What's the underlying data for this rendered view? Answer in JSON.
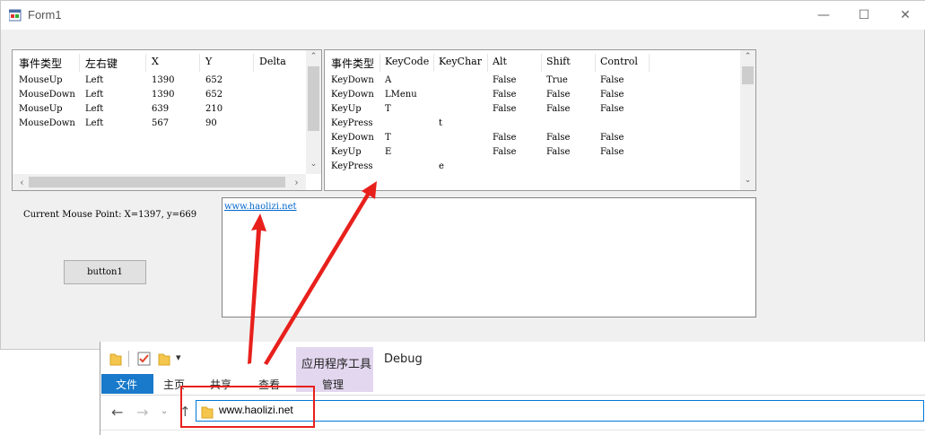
{
  "window": {
    "title": "Form1",
    "minimize": "—",
    "maximize": "☐",
    "close": "✕"
  },
  "mouse_list": {
    "columns": [
      "事件类型",
      "左右键",
      "X",
      "Y",
      "Delta"
    ],
    "rows": [
      [
        "MouseUp",
        "Left",
        "1390",
        "652"
      ],
      [
        "MouseDown",
        "Left",
        "1390",
        "652"
      ],
      [
        "MouseUp",
        "Left",
        "639",
        "210"
      ],
      [
        "MouseDown",
        "Left",
        "567",
        "90"
      ]
    ]
  },
  "key_list": {
    "columns": [
      "事件类型",
      "KeyCode",
      "KeyChar",
      "Alt",
      "Shift",
      "Control"
    ],
    "rows": [
      [
        "KeyDown",
        "A",
        "",
        "False",
        "True",
        "False"
      ],
      [
        "KeyDown",
        "LMenu",
        "",
        "False",
        "False",
        "False"
      ],
      [
        "KeyUp",
        "T",
        "",
        "False",
        "False",
        "False"
      ],
      [
        "KeyPress",
        "",
        "t",
        "",
        "",
        ""
      ],
      [
        "KeyDown",
        "T",
        "",
        "False",
        "False",
        "False"
      ],
      [
        "KeyUp",
        "E",
        "",
        "False",
        "False",
        "False"
      ],
      [
        "KeyPress",
        "",
        "e",
        "",
        "",
        ""
      ]
    ]
  },
  "mouse_point_label": "Current Mouse Point: X=1397, y=669",
  "button1_label": "button1",
  "richtext_link": "www.haolizi.net",
  "explorer": {
    "context_tab": "应用程序工具",
    "folder_name": "Debug",
    "tabs": [
      "文件",
      "主页",
      "共享",
      "查看"
    ],
    "manage_tab": "管理",
    "address": "www.haolizi.net"
  },
  "colors": {
    "annotation_red": "#e8201c",
    "file_tab_bg": "#1979ca",
    "context_tab_bg": "#e3d7f0",
    "link": "#0066cc"
  }
}
